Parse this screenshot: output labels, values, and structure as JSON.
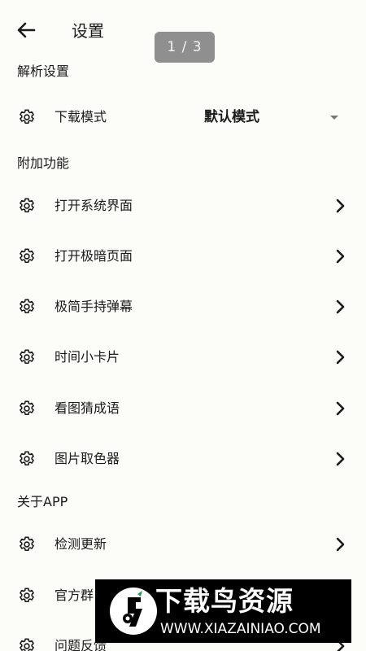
{
  "header": {
    "title": "设置",
    "pager": "1 / 3"
  },
  "sections": {
    "parse": "解析设置",
    "extra": "附加功能",
    "about": "关于APP"
  },
  "download_mode": {
    "label": "下载模式",
    "value": "默认模式"
  },
  "extra_items": [
    "打开系统界面",
    "打开极暗页面",
    "极简手持弹幕",
    "时间小卡片",
    "看图猜成语",
    "图片取色器"
  ],
  "about_items": [
    "检测更新",
    "官方群",
    "问题反馈"
  ],
  "watermark": {
    "title": "下载鸟资源",
    "url": "WWW.XIAZAINIAO.COM"
  },
  "icons": {
    "back": "arrow-left-icon",
    "setting": "gear-icon",
    "chevron": "chevron-right-icon",
    "dropdown": "caret-down-icon"
  }
}
